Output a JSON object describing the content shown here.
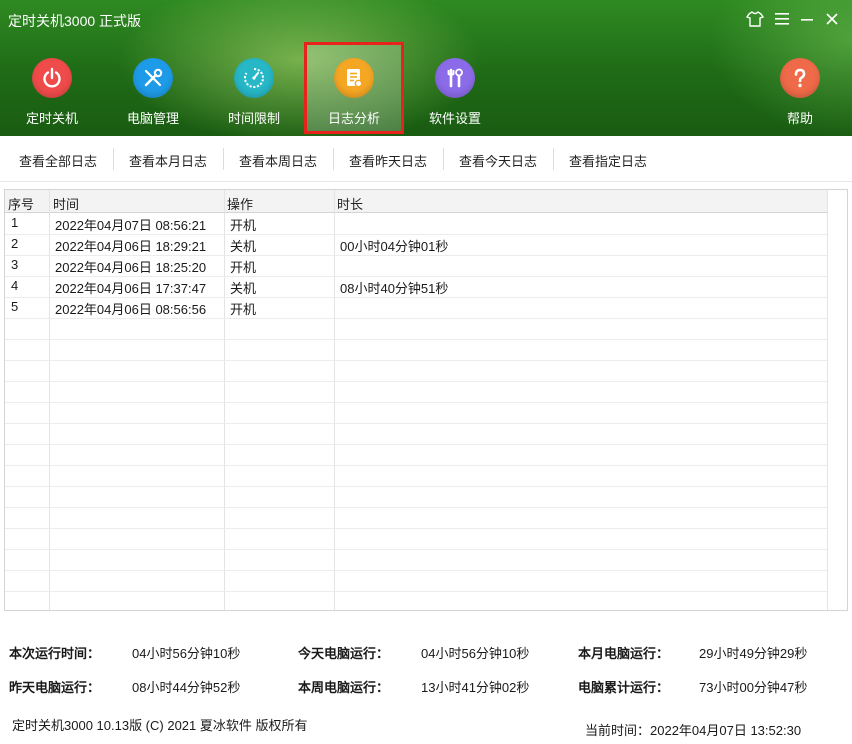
{
  "app": {
    "title": "定时关机3000 正式版"
  },
  "window_controls": [
    {
      "name": "skin-icon",
      "glyph": "👕"
    },
    {
      "name": "menu-icon",
      "glyph": "☰"
    },
    {
      "name": "minimize-icon",
      "glyph": "—"
    },
    {
      "name": "close-icon",
      "glyph": "✕"
    }
  ],
  "nav": {
    "items": [
      {
        "label": "定时关机",
        "icon": "power-icon",
        "color": "#f04b4b",
        "active": false
      },
      {
        "label": "电脑管理",
        "icon": "tools-icon",
        "color": "#1e9be8",
        "active": false
      },
      {
        "label": "时间限制",
        "icon": "timer-icon",
        "color": "#27b7c7",
        "active": false
      },
      {
        "label": "日志分析",
        "icon": "log-icon",
        "color": "#f5a623",
        "active": true
      },
      {
        "label": "软件设置",
        "icon": "settings-icon",
        "color": "#8c6be8",
        "active": false
      }
    ],
    "help": {
      "label": "帮助",
      "icon": "help-icon",
      "color": "#ef6a48"
    }
  },
  "subnav": [
    "查看全部日志",
    "查看本月日志",
    "查看本周日志",
    "查看昨天日志",
    "查看今天日志",
    "查看指定日志"
  ],
  "table": {
    "headers": [
      "序号",
      "时间",
      "操作",
      "时长"
    ],
    "rows": [
      [
        "1",
        "2022年04月07日 08:56:21",
        "开机",
        ""
      ],
      [
        "2",
        "2022年04月06日 18:29:21",
        "关机",
        "00小时04分钟01秒"
      ],
      [
        "3",
        "2022年04月06日 18:25:20",
        "开机",
        ""
      ],
      [
        "4",
        "2022年04月06日 17:37:47",
        "关机",
        "08小时40分钟51秒"
      ],
      [
        "5",
        "2022年04月06日 08:56:56",
        "开机",
        ""
      ]
    ]
  },
  "stats": {
    "row1": [
      {
        "label": "本次运行时间：",
        "value": "04小时56分钟10秒"
      },
      {
        "label": "今天电脑运行：",
        "value": "04小时56分钟10秒"
      },
      {
        "label": "本月电脑运行：",
        "value": "29小时49分钟29秒"
      }
    ],
    "row2": [
      {
        "label": "昨天电脑运行：",
        "value": "08小时44分钟52秒"
      },
      {
        "label": "本周电脑运行：",
        "value": "13小时41分钟02秒"
      },
      {
        "label": "电脑累计运行：",
        "value": "73小时00分钟47秒"
      }
    ]
  },
  "footer": {
    "copyright": "定时关机3000 10.13版 (C) 2021  夏冰软件 版权所有",
    "current_time": "当前时间：2022年04月07日 13:52:30"
  }
}
